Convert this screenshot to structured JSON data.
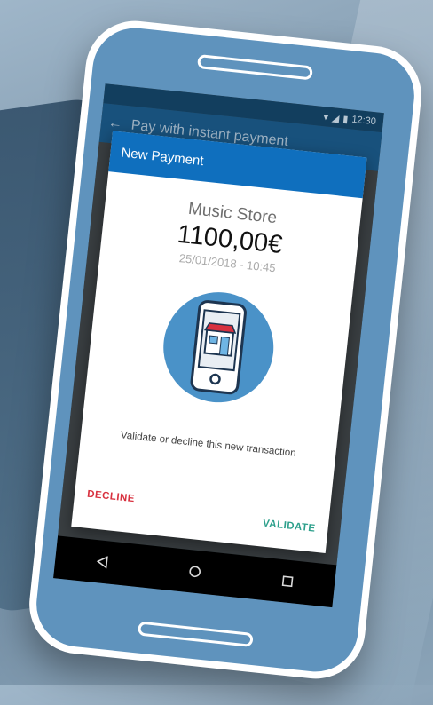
{
  "statusbar": {
    "time": "12:30"
  },
  "appbar": {
    "title": "Pay with instant payment"
  },
  "dialog": {
    "title": "New Payment",
    "merchant": "Music Store",
    "amount": "1100,00€",
    "datetime": "25/01/2018 - 10:45",
    "message": "Validate or decline this new transaction",
    "decline_label": "DECLINE",
    "validate_label": "VALIDATE",
    "colors": {
      "header": "#0f6fbe",
      "decline": "#d8313f",
      "validate": "#2ea08c",
      "illustration_circle": "#4a92c8"
    }
  },
  "navbar": {
    "back_icon": "back-triangle-icon",
    "home_icon": "home-circle-icon",
    "recents_icon": "recents-square-icon"
  }
}
